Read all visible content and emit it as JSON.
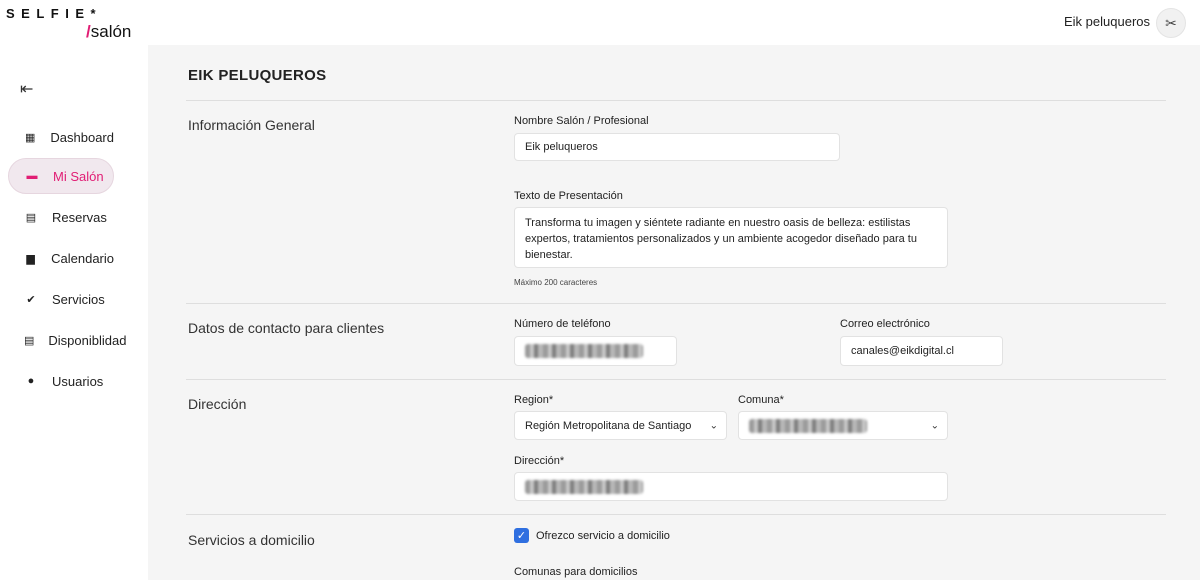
{
  "brand": {
    "top": "SELFIE*",
    "slash": "/",
    "bottom": "salón"
  },
  "user": {
    "name": "Eik peluqueros",
    "avatar_icon": "scissors-icon"
  },
  "sidebar": {
    "collapse_icon": "collapse-left-icon",
    "items": [
      {
        "label": "Dashboard",
        "icon": "grid-icon",
        "active": false
      },
      {
        "label": "Mi Salón",
        "icon": "store-icon",
        "active": true
      },
      {
        "label": "Reservas",
        "icon": "clipboard-icon",
        "active": false
      },
      {
        "label": "Calendario",
        "icon": "calendar-icon",
        "active": false
      },
      {
        "label": "Servicios",
        "icon": "badge-check-icon",
        "active": false
      },
      {
        "label": "Disponiblidad",
        "icon": "clipboard-icon",
        "active": false
      },
      {
        "label": "Usuarios",
        "icon": "user-icon",
        "active": false
      }
    ]
  },
  "page": {
    "title": "EIK PELUQUEROS"
  },
  "general": {
    "section": "Información General",
    "name_label": "Nombre Salón / Profesional",
    "name_value": "Eik peluqueros",
    "presentation_label": "Texto de Presentación",
    "presentation_value": "Transforma tu imagen y siéntete radiante en nuestro oasis de belleza: estilistas expertos, tratamientos personalizados y un ambiente acogedor diseñado para tu bienestar.",
    "presentation_hint": "Máximo 200 caracteres"
  },
  "contact": {
    "section": "Datos de contacto para clientes",
    "phone_label": "Número de teléfono",
    "email_label": "Correo electrónico",
    "email_value": "canales@eikdigital.cl"
  },
  "address": {
    "section": "Dirección",
    "region_label": "Region*",
    "region_value": "Región Metropolitana de Santiago",
    "comuna_label": "Comuna*",
    "address_label": "Dirección*"
  },
  "home_service": {
    "section": "Servicios a domicilio",
    "checkbox_label": "Ofrezco servicio a domicilio",
    "checked": true,
    "comunas_label": "Comunas para domicilios"
  },
  "colors": {
    "accent": "#e11d74",
    "checkbox": "#2f6fe0",
    "background": "#f5f5f5"
  }
}
